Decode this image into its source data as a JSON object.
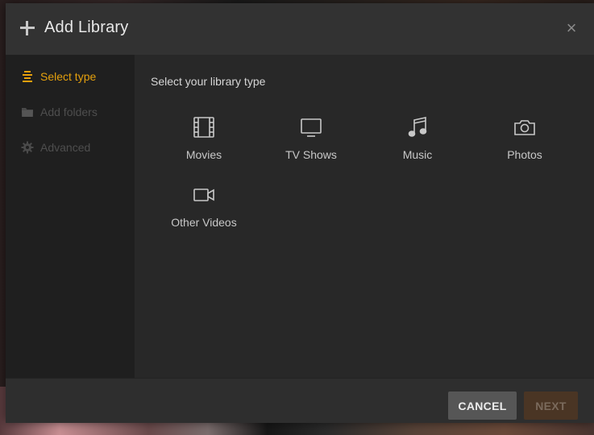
{
  "dialog": {
    "title": "Add Library",
    "close_glyph": "×"
  },
  "sidebar": {
    "items": [
      {
        "label": "Select type",
        "icon": "list-icon",
        "state": "active"
      },
      {
        "label": "Add folders",
        "icon": "folder-icon",
        "state": "disabled"
      },
      {
        "label": "Advanced",
        "icon": "gear-icon",
        "state": "disabled"
      }
    ]
  },
  "main": {
    "heading": "Select your library type",
    "types": [
      {
        "label": "Movies",
        "icon": "film-icon"
      },
      {
        "label": "TV Shows",
        "icon": "tv-icon"
      },
      {
        "label": "Music",
        "icon": "music-note-icon"
      },
      {
        "label": "Photos",
        "icon": "camera-icon"
      },
      {
        "label": "Other Videos",
        "icon": "video-camera-icon"
      }
    ]
  },
  "footer": {
    "cancel_label": "CANCEL",
    "next_label": "NEXT"
  },
  "colors": {
    "accent": "#e5a00d",
    "dialog_bg": "#282828",
    "sidebar_bg": "#1f1f1f"
  }
}
